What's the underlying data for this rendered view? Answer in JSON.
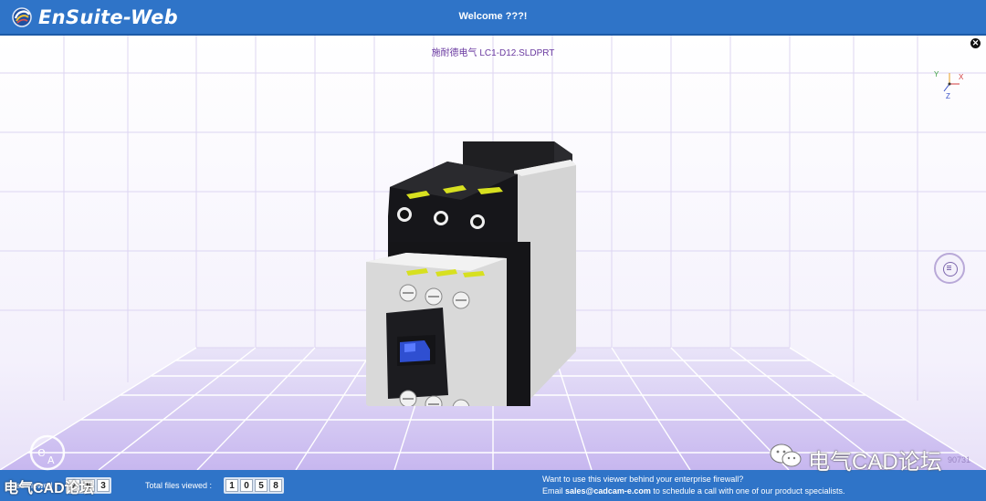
{
  "app": {
    "name": "EnSuite-Web",
    "welcome": "Welcome ???!"
  },
  "viewer": {
    "filename": "施耐德电气 LC1-D12.SLDPRT",
    "axes": {
      "x": "X",
      "y": "Y",
      "z": "Z"
    }
  },
  "icons": {
    "logo": "ensuite-logo-icon",
    "close": "close-icon",
    "menu": "menu-icon",
    "axis": "axis-triad-icon",
    "model": "contactor-3d-model"
  },
  "footer": {
    "counter1_label": "Files viewed :",
    "counter1_digits": [
      "2",
      "6",
      "3"
    ],
    "total_label": "Total files viewed :",
    "total_digits": [
      "1",
      "0",
      "5",
      "8"
    ],
    "promo_line1": "Want to use this viewer behind your enterprise firewall?",
    "promo_prefix": "Email ",
    "promo_email": "sales@cadcam-e.com",
    "promo_suffix": " to schedule a call with one of our product specialists."
  },
  "watermark": {
    "brand": "电气CAD论坛",
    "code": "90731"
  },
  "colors": {
    "header": "#2f74c8",
    "accent": "#6a3aa0",
    "grid": "#d6cdef"
  }
}
